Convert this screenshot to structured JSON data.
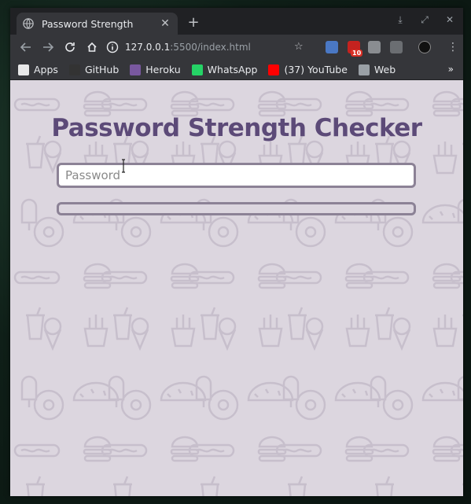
{
  "browser": {
    "tab_title": "Password Strength",
    "tab_close": "✕",
    "new_tab": "+",
    "url_host": "127.0.0.1",
    "url_path": ":5500/index.html",
    "mail_badge": "10"
  },
  "bookmarks": [
    {
      "label": "Apps",
      "icon": "apps-grid-icon",
      "color": "#e8e8e8"
    },
    {
      "label": "GitHub",
      "icon": "github-icon",
      "color": "#333333"
    },
    {
      "label": "Heroku",
      "icon": "heroku-icon",
      "color": "#79589f"
    },
    {
      "label": "WhatsApp",
      "icon": "whatsapp-icon",
      "color": "#25d366"
    },
    {
      "label": "(37) YouTube",
      "icon": "youtube-icon",
      "color": "#ff0000"
    },
    {
      "label": "Web",
      "icon": "folder-icon",
      "color": "#9aa0a6"
    }
  ],
  "bookmarks_more": "»",
  "page": {
    "heading": "Password Strength Checker",
    "password_placeholder": "Password",
    "password_value": "",
    "strength": 0
  },
  "colors": {
    "accent": "#5c4a78",
    "background": "#dcd6df",
    "border": "#8c8296"
  }
}
